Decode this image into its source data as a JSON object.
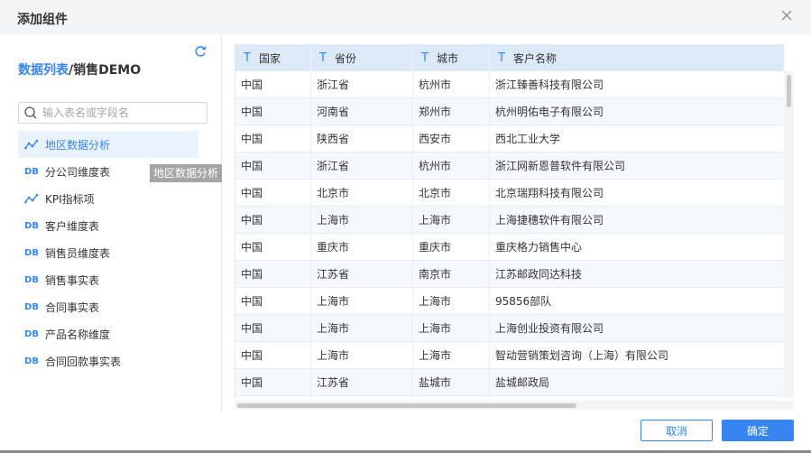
{
  "dialog": {
    "title": "添加组件",
    "close_icon": "close-icon"
  },
  "left": {
    "breadcrumb_link": "数据列表",
    "breadcrumb_sep": "/",
    "breadcrumb_current": "销售DEMO",
    "search_placeholder": "输入表名或字段名",
    "tooltip": "地区数据分析",
    "items": [
      {
        "label": "地区数据分析",
        "icon": "analysis-icon",
        "active": true
      },
      {
        "label": "分公司维度表",
        "icon": "db-icon"
      },
      {
        "label": "KPI指标项",
        "icon": "analysis-icon"
      },
      {
        "label": "客户维度表",
        "icon": "db-icon"
      },
      {
        "label": "销售员维度表",
        "icon": "db-icon"
      },
      {
        "label": "销售事实表",
        "icon": "db-icon"
      },
      {
        "label": "合同事实表",
        "icon": "db-icon"
      },
      {
        "label": "产品名称维度",
        "icon": "db-icon"
      },
      {
        "label": "合同回款事实表",
        "icon": "db-icon"
      }
    ],
    "db_glyph": "DB"
  },
  "table": {
    "type_glyph": "T",
    "columns": [
      "国家",
      "省份",
      "城市",
      "客户名称"
    ],
    "rows": [
      [
        "中国",
        "浙江省",
        "杭州市",
        "浙江臻善科技有限公司"
      ],
      [
        "中国",
        "河南省",
        "郑州市",
        "杭州明佑电子有限公司"
      ],
      [
        "中国",
        "陕西省",
        "西安市",
        "西北工业大学"
      ],
      [
        "中国",
        "浙江省",
        "杭州市",
        "浙江网新恩普软件有限公司"
      ],
      [
        "中国",
        "北京市",
        "北京市",
        "北京瑞翔科技有限公司"
      ],
      [
        "中国",
        "上海市",
        "上海市",
        "上海捷穗软件有限公司"
      ],
      [
        "中国",
        "重庆市",
        "重庆市",
        "重庆格力销售中心"
      ],
      [
        "中国",
        "江苏省",
        "南京市",
        "江苏邮政同达科技"
      ],
      [
        "中国",
        "上海市",
        "上海市",
        "95856部队"
      ],
      [
        "中国",
        "上海市",
        "上海市",
        "上海创业投资有限公司"
      ],
      [
        "中国",
        "上海市",
        "上海市",
        "智动营销策划咨询（上海）有限公司"
      ],
      [
        "中国",
        "江苏省",
        "盐城市",
        "盐城邮政局"
      ],
      [
        "",
        "",
        "",
        ""
      ]
    ]
  },
  "footer": {
    "cancel": "取消",
    "ok": "确定"
  },
  "colors": {
    "accent": "#3685f2",
    "header_bg": "#dbe9f9",
    "active_bg": "#eaf2fd"
  }
}
